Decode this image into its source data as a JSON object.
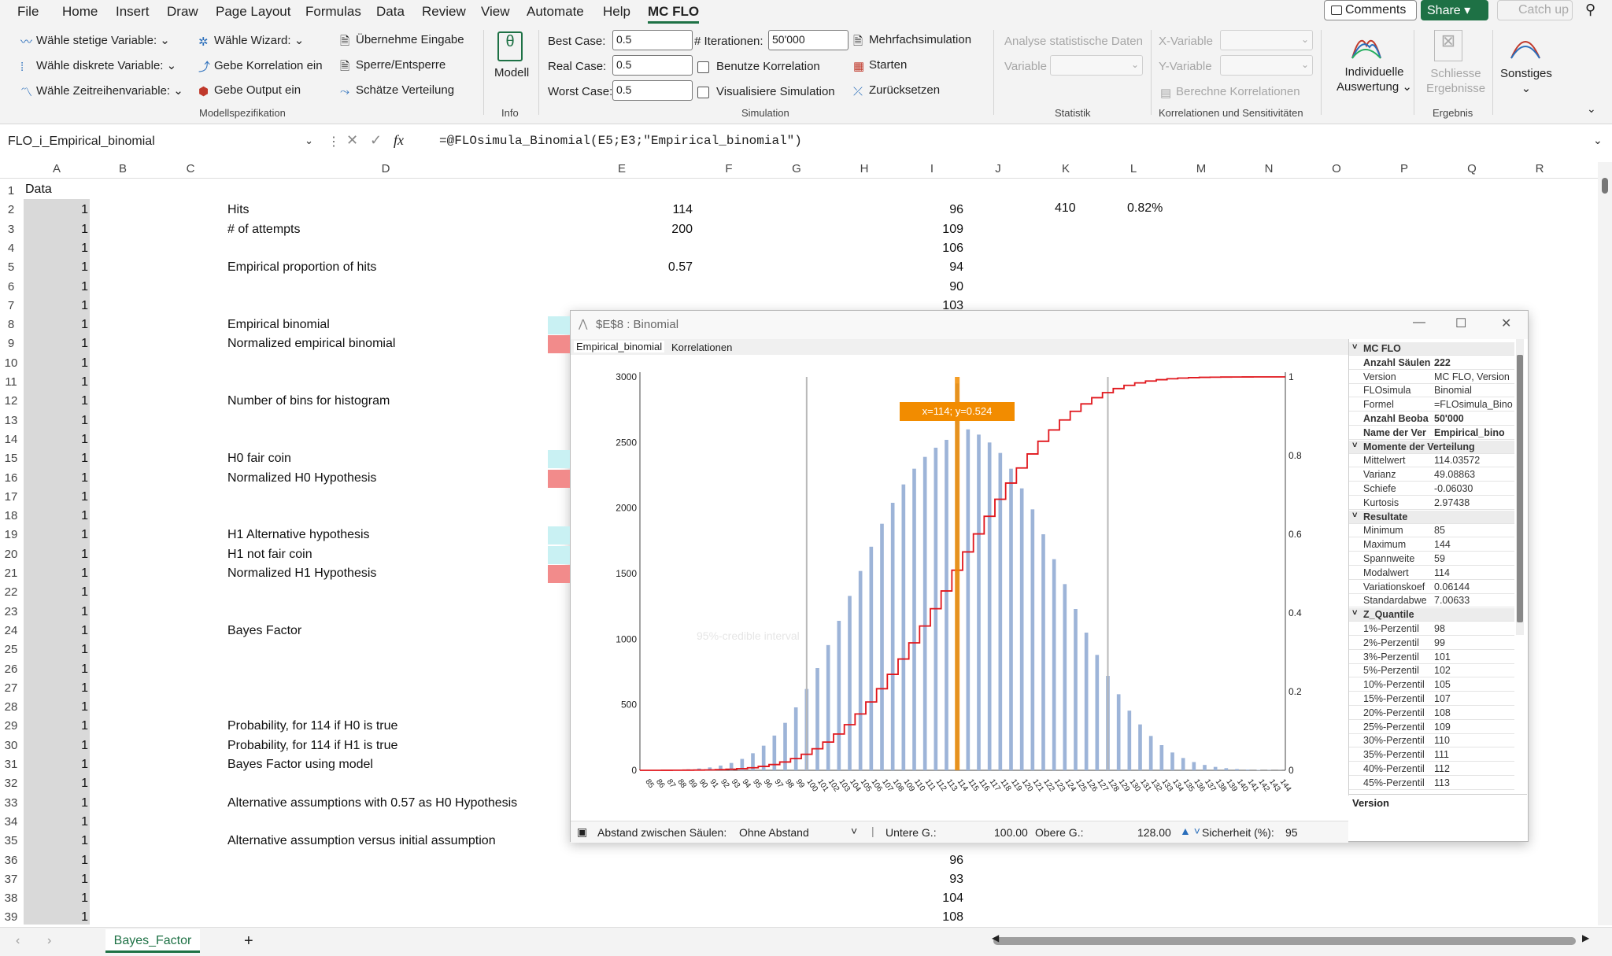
{
  "menu": {
    "items": [
      "File",
      "Home",
      "Insert",
      "Draw",
      "Page Layout",
      "Formulas",
      "Data",
      "Review",
      "View",
      "Automate",
      "Help",
      "MC FLO"
    ],
    "comments": "Comments",
    "share": "Share",
    "catchup": "Catch up"
  },
  "ribbon": {
    "mod1": "Wähle stetige Variable:",
    "mod2": "Wähle diskrete Variable:",
    "mod3": "Wähle Zeitreihenvariable:",
    "mod4": "Wähle Wizard:",
    "mod5": "Gebe Korrelation ein",
    "mod6": "Gebe Output ein",
    "mod7": "Übernehme Eingabe",
    "mod8": "Sperre/Entsperre",
    "mod9": "Schätze Verteilung",
    "grp_model": "Modellspezifikation",
    "modell": "Modell",
    "grp_info": "Info",
    "best_label": "Best Case:",
    "best_val": "0.5",
    "real_label": "Real Case:",
    "real_val": "0.5",
    "worst_label": "Worst Case:",
    "worst_val": "0.5",
    "iter_label": "# Iterationen:",
    "iter_val": "50'000",
    "benutze": "Benutze Korrelation",
    "visual": "Visualisiere Simulation",
    "mehrfach": "Mehrfachsimulation",
    "starten": "Starten",
    "zurueck": "Zurücksetzen",
    "grp_sim": "Simulation",
    "analyse": "Analyse statistische Daten",
    "variable": "Variable",
    "grp_stat": "Statistik",
    "xvar": "X-Variable",
    "yvar": "Y-Variable",
    "berechne": "Berechne Korrelationen",
    "grp_korr": "Korrelationen und Sensitivitäten",
    "indiv1": "Individuelle",
    "indiv2": "Auswertung",
    "schl1": "Schliesse",
    "schl2": "Ergebnisse",
    "grp_erg": "Ergebnis",
    "sonst": "Sonstiges"
  },
  "formula_bar": {
    "name": "FLO_i_Empirical_binomial",
    "fx": "fx",
    "formula": "=@FLOsimula_Binomial(E5;E3;\"Empirical_binomial\")"
  },
  "columns": [
    "A",
    "B",
    "C",
    "D",
    "E",
    "F",
    "G",
    "H",
    "I",
    "J",
    "K",
    "L",
    "M",
    "N",
    "O",
    "P",
    "Q",
    "R"
  ],
  "rows": [
    "1",
    "2",
    "3",
    "4",
    "5",
    "6",
    "7",
    "8",
    "9",
    "10",
    "11",
    "12",
    "13",
    "14",
    "15",
    "16",
    "17",
    "18",
    "19",
    "20",
    "21",
    "22",
    "23",
    "24",
    "25",
    "26",
    "27",
    "28",
    "29",
    "30",
    "31",
    "32",
    "33",
    "34",
    "35",
    "36",
    "37",
    "38",
    "39"
  ],
  "col_a": {
    "header": "Data",
    "value": "1"
  },
  "labels": [
    {
      "row": 2,
      "text": "Hits"
    },
    {
      "row": 3,
      "text": "# of attempts"
    },
    {
      "row": 5,
      "text": "Empirical proportion of hits"
    },
    {
      "row": 8,
      "text": "Empirical binomial"
    },
    {
      "row": 9,
      "text": "Normalized empirical binomial"
    },
    {
      "row": 12,
      "text": "Number of bins for histogram"
    },
    {
      "row": 15,
      "text": "H0 fair coin"
    },
    {
      "row": 16,
      "text": "Normalized H0 Hypothesis"
    },
    {
      "row": 19,
      "text": "H1 Alternative hypothesis"
    },
    {
      "row": 20,
      "text": "H1 not fair coin"
    },
    {
      "row": 21,
      "text": "Normalized H1 Hypothesis"
    },
    {
      "row": 24,
      "text": "Bayes Factor"
    },
    {
      "row": 29,
      "text": "Probability, for 114 if H0 is true"
    },
    {
      "row": 30,
      "text": "Probability, for 114 if H1 is true"
    },
    {
      "row": 31,
      "text": "Bayes Factor using model"
    },
    {
      "row": 33,
      "text": "Alternative assumptions with 0.57 as H0 Hypothesis"
    },
    {
      "row": 35,
      "text": "Alternative assumption versus initial assumption"
    }
  ],
  "col_e": [
    {
      "row": 2,
      "text": "114"
    },
    {
      "row": 3,
      "text": "200"
    },
    {
      "row": 5,
      "text": "0.57"
    }
  ],
  "col_i": [
    {
      "row": 2,
      "text": "96"
    },
    {
      "row": 3,
      "text": "109"
    },
    {
      "row": 4,
      "text": "106"
    },
    {
      "row": 5,
      "text": "94"
    },
    {
      "row": 6,
      "text": "90"
    },
    {
      "row": 7,
      "text": "103"
    },
    {
      "row": 36,
      "text": "96"
    },
    {
      "row": 37,
      "text": "93"
    },
    {
      "row": 38,
      "text": "104"
    },
    {
      "row": 39,
      "text": "108"
    }
  ],
  "k2": "410",
  "l2": "0.82%",
  "sheet_tab": "Bayes_Factor",
  "add_sheet": "+",
  "dialog": {
    "title": "$E$8 : Binomial",
    "tab1": "Empirical_binomial",
    "tab2": "Korrelationen",
    "tooltip": "x=114; y=0.524",
    "bg_text": "95%-credible interval",
    "status_gap_label": "Abstand zwischen Säulen:",
    "status_gap_val": "Ohne Abstand",
    "lower_label": "Untere G.:",
    "lower_val": "100.00",
    "upper_label": "Obere G.:",
    "upper_val": "128.00",
    "conf_label": "Sicherheit (%):",
    "conf_val": "95",
    "props": [
      {
        "k": "MC FLO",
        "v": "",
        "head": true
      },
      {
        "k": "Anzahl Säulen",
        "v": "222",
        "bold": true
      },
      {
        "k": "Version",
        "v": "MC FLO, Version"
      },
      {
        "k": "FLOsimula",
        "v": "Binomial"
      },
      {
        "k": "Formel",
        "v": "=FLOsimula_Bino"
      },
      {
        "k": "Anzahl Beoba",
        "v": "50'000",
        "bold": true
      },
      {
        "k": "Name der Ver",
        "v": "Empirical_bino",
        "bold": true
      },
      {
        "k": "Momente der Verteilung",
        "v": "",
        "head": true
      },
      {
        "k": "Mittelwert",
        "v": "114.03572"
      },
      {
        "k": "Varianz",
        "v": "49.08863"
      },
      {
        "k": "Schiefe",
        "v": "-0.06030"
      },
      {
        "k": "Kurtosis",
        "v": "2.97438"
      },
      {
        "k": "Resultate",
        "v": "",
        "head": true
      },
      {
        "k": "Minimum",
        "v": "85"
      },
      {
        "k": "Maximum",
        "v": "144"
      },
      {
        "k": "Spannweite",
        "v": "59"
      },
      {
        "k": "Modalwert",
        "v": "114"
      },
      {
        "k": "Variationskoef",
        "v": "0.06144"
      },
      {
        "k": "Standardabwe",
        "v": "7.00633"
      },
      {
        "k": "Z_Quantile",
        "v": "",
        "head": true
      },
      {
        "k": "1%-Perzentil",
        "v": "98"
      },
      {
        "k": "2%-Perzentil",
        "v": "99"
      },
      {
        "k": "3%-Perzentil",
        "v": "101"
      },
      {
        "k": "5%-Perzentil",
        "v": "102"
      },
      {
        "k": "10%-Perzentil",
        "v": "105"
      },
      {
        "k": "15%-Perzentil",
        "v": "107"
      },
      {
        "k": "20%-Perzentil",
        "v": "108"
      },
      {
        "k": "25%-Perzentil",
        "v": "109"
      },
      {
        "k": "30%-Perzentil",
        "v": "110"
      },
      {
        "k": "35%-Perzentil",
        "v": "111"
      },
      {
        "k": "40%-Perzentil",
        "v": "112"
      },
      {
        "k": "45%-Perzentil",
        "v": "113"
      }
    ],
    "version_label": "Version"
  },
  "chart_data": {
    "type": "bar",
    "ylim": [
      0,
      3000
    ],
    "y_ticks": [
      "0",
      "500",
      "1000",
      "1500",
      "2000",
      "2500",
      "3000"
    ],
    "y2_ticks": [
      "0",
      "0.2",
      "0.4",
      "0.6",
      "0.8",
      "1"
    ],
    "x": [
      85,
      86,
      87,
      88,
      89,
      90,
      91,
      92,
      93,
      94,
      95,
      96,
      97,
      98,
      99,
      100,
      101,
      102,
      103,
      104,
      105,
      106,
      107,
      108,
      109,
      110,
      111,
      112,
      113,
      114,
      115,
      116,
      117,
      118,
      119,
      120,
      121,
      122,
      123,
      124,
      125,
      126,
      127,
      128,
      129,
      130,
      131,
      132,
      133,
      134,
      135,
      136,
      137,
      138,
      139,
      140,
      141,
      142,
      143,
      144
    ],
    "values": [
      1,
      2,
      3,
      5,
      8,
      14,
      22,
      36,
      56,
      87,
      130,
      188,
      265,
      362,
      480,
      620,
      780,
      955,
      1140,
      1330,
      1520,
      1705,
      1880,
      2040,
      2180,
      2300,
      2390,
      2460,
      2520,
      2950,
      2600,
      2560,
      2500,
      2420,
      2300,
      2150,
      1990,
      1800,
      1610,
      1420,
      1230,
      1050,
      880,
      720,
      580,
      455,
      350,
      262,
      192,
      136,
      94,
      63,
      41,
      26,
      16,
      10,
      6,
      3,
      2,
      1
    ],
    "cumulative_label": "cumulative",
    "bounds": [
      100,
      128
    ],
    "marker_x": 114,
    "colors": {
      "bars": "#9db4d8",
      "cdf": "#e0151b",
      "marker": "#f28c00",
      "bounds": "#b8b8b8"
    }
  }
}
